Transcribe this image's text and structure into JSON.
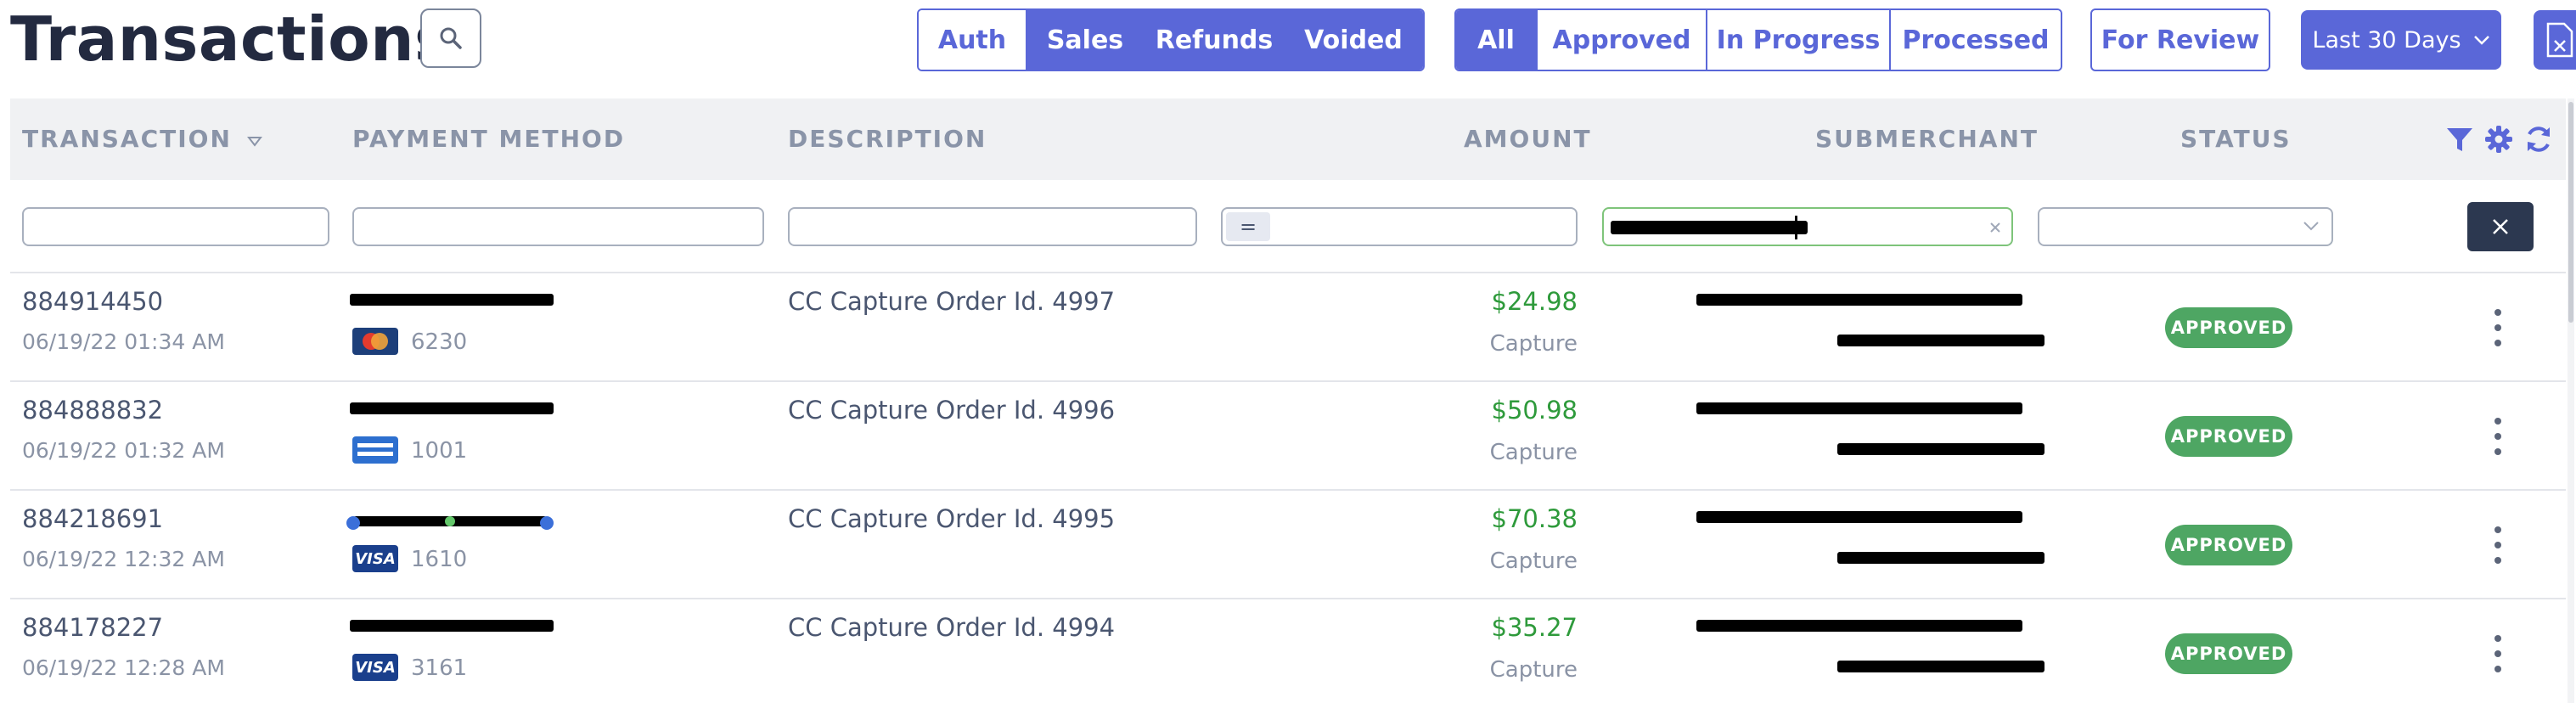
{
  "page": {
    "title": "Transactions"
  },
  "type_tabs": [
    "Auth",
    "Sales",
    "Refunds",
    "Voided"
  ],
  "type_tabs_active": [
    "Sales",
    "Refunds",
    "Voided"
  ],
  "status_tabs": [
    "All",
    "Approved",
    "In Progress",
    "Processed"
  ],
  "status_tabs_active": "All",
  "review_button": "For Review",
  "range_button": "Last 30 Days",
  "columns": {
    "transaction": "TRANSACTION",
    "payment_method": "PAYMENT METHOD",
    "description": "DESCRIPTION",
    "amount": "AMOUNT",
    "submerchant": "SUBMERCHANT",
    "status": "STATUS"
  },
  "filters": {
    "amount_operator": "="
  },
  "colors": {
    "accent": "#5a67d8",
    "approved": "#4ea663",
    "amount": "#2e9a3b"
  },
  "rows": [
    {
      "id": "884914450",
      "date": "06/19/22 01:34 AM",
      "card_brand": "mastercard",
      "last4": "6230",
      "description": "CC Capture Order Id. 4997",
      "amount": "$24.98",
      "amount_type": "Capture",
      "status": "APPROVED"
    },
    {
      "id": "884888832",
      "date": "06/19/22 01:32 AM",
      "card_brand": "amex",
      "last4": "1001",
      "description": "CC Capture Order Id. 4996",
      "amount": "$50.98",
      "amount_type": "Capture",
      "status": "APPROVED"
    },
    {
      "id": "884218691",
      "date": "06/19/22 12:32 AM",
      "card_brand": "visa",
      "last4": "1610",
      "description": "CC Capture Order Id. 4995",
      "amount": "$70.38",
      "amount_type": "Capture",
      "status": "APPROVED"
    },
    {
      "id": "884178227",
      "date": "06/19/22 12:28 AM",
      "card_brand": "visa",
      "last4": "3161",
      "description": "CC Capture Order Id. 4994",
      "amount": "$35.27",
      "amount_type": "Capture",
      "status": "APPROVED"
    }
  ]
}
